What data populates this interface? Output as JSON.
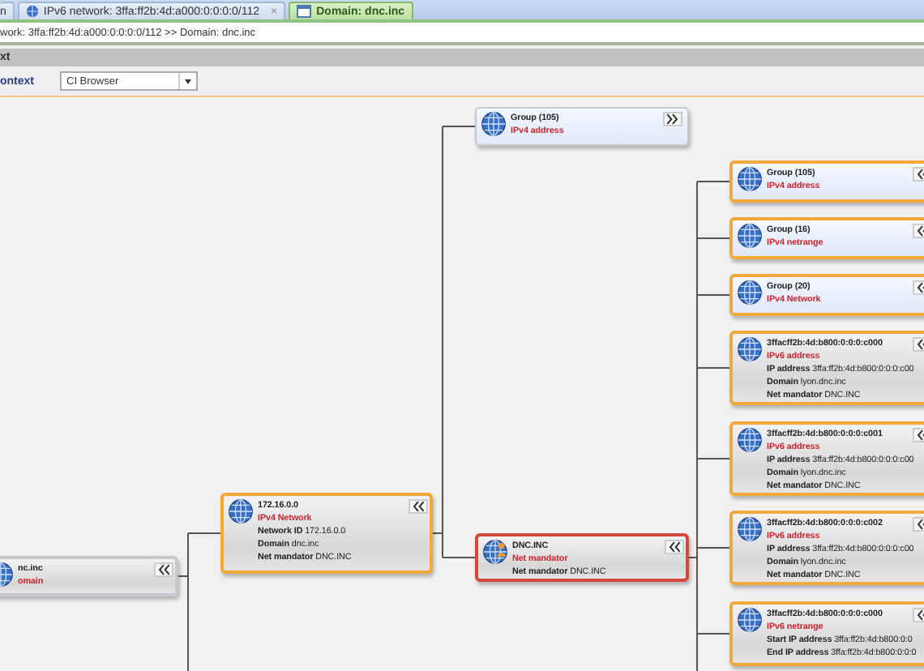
{
  "tabs": [
    {
      "label": "n",
      "selected": false
    },
    {
      "label": "IPv6 network: 3ffa:ff2b:4d:a000:0:0:0:0/112",
      "selected": false,
      "close": "×"
    },
    {
      "label": "Domain: dnc.inc",
      "selected": true
    }
  ],
  "breadcrumb": "work: 3ffa:ff2b:4d:a000:0:0:0:0/112 >> Domain: dnc.inc",
  "panel": {
    "title": "xt",
    "context_label": "ontext",
    "context_value": "CI Browser"
  },
  "graph": {
    "title": "nc.inc",
    "type": "omain",
    "kind": "object",
    "selected": false,
    "expanded": true,
    "continues": true,
    "children": [
      {
        "title": "172.16.0.0",
        "type": "IPv4 Network",
        "kind": "object",
        "selected": true,
        "expanded": true,
        "properties": [
          {
            "label": "Network ID",
            "value": "172.16.0.0"
          },
          {
            "label": "Domain",
            "value": "dnc.inc"
          },
          {
            "label": "Net mandator",
            "value": "DNC.INC"
          }
        ],
        "children": [
          {
            "title": "Group (105)",
            "type": "IPv4 address",
            "kind": "group",
            "selected": false,
            "expanded": false
          },
          {
            "title": "DNC.INC",
            "type": "Net mandator",
            "kind": "mandator",
            "selected": false,
            "expanded": true,
            "continues": true,
            "properties": [
              {
                "label": "Net mandator",
                "value": "DNC.INC"
              }
            ],
            "children": [
              {
                "title": "Group (105)",
                "type": "IPv4 address",
                "kind": "group",
                "selected": true,
                "expanded": true
              },
              {
                "title": "Group (16)",
                "type": "IPv4 netrange",
                "kind": "group",
                "selected": true,
                "expanded": true
              },
              {
                "title": "Group (20)",
                "type": "IPv4 Network",
                "kind": "group",
                "selected": true,
                "expanded": true
              },
              {
                "title": "3ffacff2b:4d:b800:0:0:0:c000",
                "type": "IPv6 address",
                "kind": "object",
                "selected": true,
                "expanded": true,
                "properties": [
                  {
                    "label": "IP address",
                    "value": "3ffa:ff2b:4d:b800:0:0:0:c00"
                  },
                  {
                    "label": "Domain",
                    "value": "lyon.dnc.inc"
                  },
                  {
                    "label": "Net mandator",
                    "value": "DNC.INC"
                  }
                ]
              },
              {
                "title": "3ffacff2b:4d:b800:0:0:0:c001",
                "type": "IPv6 address",
                "kind": "object",
                "selected": true,
                "expanded": true,
                "properties": [
                  {
                    "label": "IP address",
                    "value": "3ffa:ff2b:4d:b800:0:0:0:c00"
                  },
                  {
                    "label": "Domain",
                    "value": "lyon.dnc.inc"
                  },
                  {
                    "label": "Net mandator",
                    "value": "DNC.INC"
                  }
                ]
              },
              {
                "title": "3ffacff2b:4d:b800:0:0:0:c002",
                "type": "IPv6 address",
                "kind": "object",
                "selected": true,
                "expanded": true,
                "properties": [
                  {
                    "label": "IP address",
                    "value": "3ffa:ff2b:4d:b800:0:0:0:c00"
                  },
                  {
                    "label": "Domain",
                    "value": "lyon.dnc.inc"
                  },
                  {
                    "label": "Net mandator",
                    "value": "DNC.INC"
                  }
                ]
              },
              {
                "title": "3ffacff2b:4d:b800:0:0:0:c000",
                "type": "IPv6 netrange",
                "kind": "object",
                "selected": true,
                "expanded": true,
                "properties": [
                  {
                    "label": "Start IP address",
                    "value": "3ffa:ff2b:4d:b800:0:0"
                  },
                  {
                    "label": "End IP address",
                    "value": "3ffa:ff2b:4d:b800:0:0:0"
                  }
                ]
              }
            ]
          }
        ]
      }
    ]
  }
}
